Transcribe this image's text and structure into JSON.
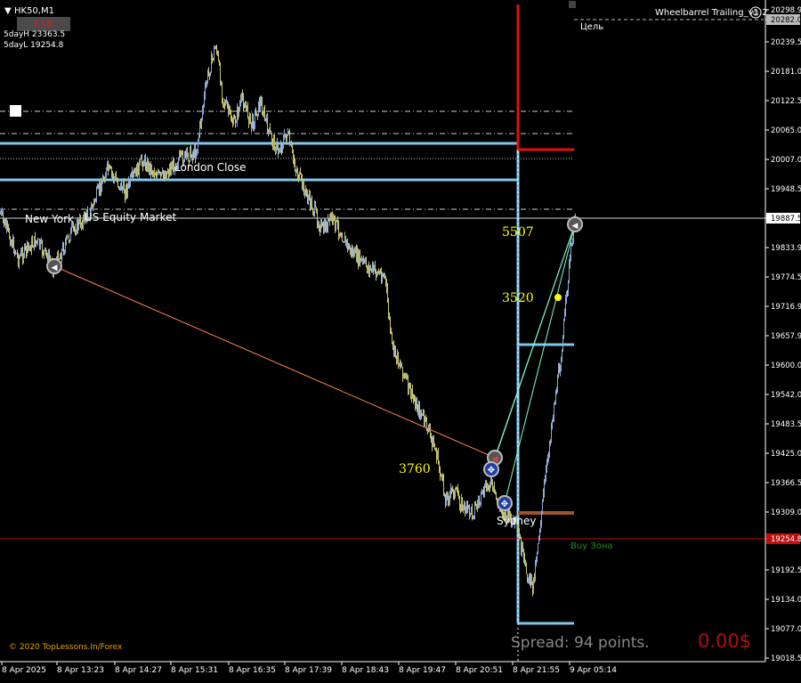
{
  "header": {
    "symbol": "HK50,M1",
    "esb_badge": "ESB",
    "day_high": "5dayH 23363.5",
    "day_low": "5dayL 19254.8",
    "indicator_name": "Wheelbarrel Trailing_v1.2",
    "target_label": "Цель"
  },
  "labels": {
    "london_close": "London Close",
    "new_york": "New York",
    "us_equity": "US Equity Market",
    "sydney": "Sydney",
    "buy_zone": "Buy Зона",
    "copyright": "© 2020 TopLessons.In/Forex",
    "spread": "Spread: 94 points.",
    "profit": "0.00$"
  },
  "markers": {
    "m1": "5507",
    "m2": "3520",
    "m3": "3760"
  },
  "chart_data": {
    "type": "line",
    "symbol": "HK50",
    "timeframe": "M1",
    "y_ticks": [
      "20298.9",
      "20282.0",
      "20239.59",
      "20181.08",
      "20122.57",
      "20065.06",
      "20007.0",
      "19948.5",
      "19887.5",
      "19833.9",
      "19774.5",
      "19716.9",
      "19657.9",
      "19600.0",
      "19542.0",
      "19483.5",
      "19425.0",
      "19366.5",
      "19309.0",
      "19254.8",
      "19192.5",
      "19134.0",
      "19077.0",
      "19018.5"
    ],
    "x_ticks": [
      "8 Apr 2025",
      "8 Apr 13:23",
      "8 Apr 14:27",
      "8 Apr 15:31",
      "8 Apr 16:35",
      "8 Apr 17:39",
      "8 Apr 18:43",
      "8 Apr 19:47",
      "8 Apr 20:51",
      "8 Apr 21:55",
      "9 Apr 05:14"
    ],
    "current_price": "19887.5",
    "low_price_line": "19254.8",
    "target_price_line": "20282.0",
    "ylim": [
      19018.5,
      20298.9
    ],
    "colors": {
      "price_up": "#8fa8d6",
      "price_down": "#c8c46a",
      "level_line": "#7ec8ee",
      "red_level": "#e01010",
      "price_red_line": "#c01010",
      "brown_level": "#a0522d",
      "trend_line": "#ff7f50",
      "marker_text": "#ffff00",
      "buy_zone": "#1e8c1e",
      "profit": "#b01010",
      "spread": "#888888"
    }
  }
}
